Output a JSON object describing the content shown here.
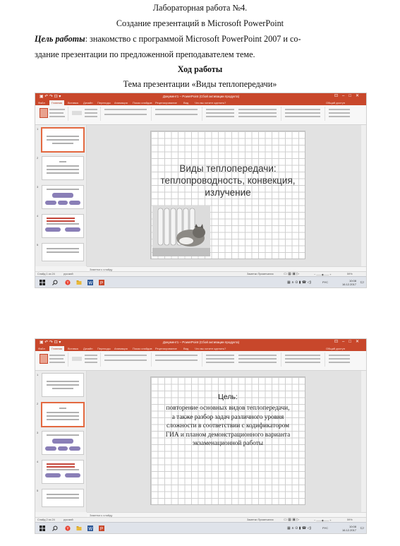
{
  "document": {
    "heading_line1": "Лабораторная работа №4.",
    "heading_line2": "Создание презентаций в Microsoft PowerPoint",
    "goal_label": "Цель работы",
    "goal_text_line1": ": знакомство с программой Microsoft PowerPoint 2007 и со-",
    "goal_text_line2": "здание презентации по предложенной преподавателем теме.",
    "progress_heading": "Ход работы",
    "topic": "Тема презентации «Виды теплопередачи»"
  },
  "screenshot1": {
    "window_title": "Документ1 – PowerPoint (Сбой активации продукта)",
    "tabs": [
      "Файл",
      "Главная",
      "Вставка",
      "Дизайн",
      "Переходы",
      "Анимация",
      "Показ слайдов",
      "Рецензирование",
      "Вид",
      "Что вы хотите сделать?"
    ],
    "share": "Общий доступ",
    "slide_title": "Виды теплопередачи: теплопроводность, конвекция, излучение",
    "notes_placeholder": "Заметки к слайду",
    "status_left": "Слайд 1 из 24",
    "status_lang": "русский",
    "status_right": "Заметки   Примечания",
    "zoom": "59%",
    "clock_time": "10:08",
    "clock_date": "16.12.2017",
    "lang_indicator": "РУС"
  },
  "screenshot2": {
    "window_title": "Документ1 – PowerPoint (Сбой активации продукта)",
    "tabs": [
      "Файл",
      "Главная",
      "Вставка",
      "Дизайн",
      "Переходы",
      "Анимация",
      "Показ слайдов",
      "Рецензирование",
      "Вид",
      "Что вы хотите сделать?"
    ],
    "share": "Общий доступ",
    "slide_heading": "Цель:",
    "slide_body": "повторение основных видов теплопередачи, а также разбор задач различного уровня сложности в соответствии с кодификатором ГИА и планом демонстрационного варианта экзаменационной работы",
    "notes_placeholder": "Заметки к слайду",
    "status_left": "Слайд 2 из 24",
    "status_lang": "русский",
    "status_right": "Заметки   Примечания",
    "zoom": "59%",
    "clock_time": "10:08",
    "clock_date": "16.12.2017",
    "lang_indicator": "РУС"
  },
  "colors": {
    "accent": "#c8472b",
    "selection": "#e3683f"
  }
}
